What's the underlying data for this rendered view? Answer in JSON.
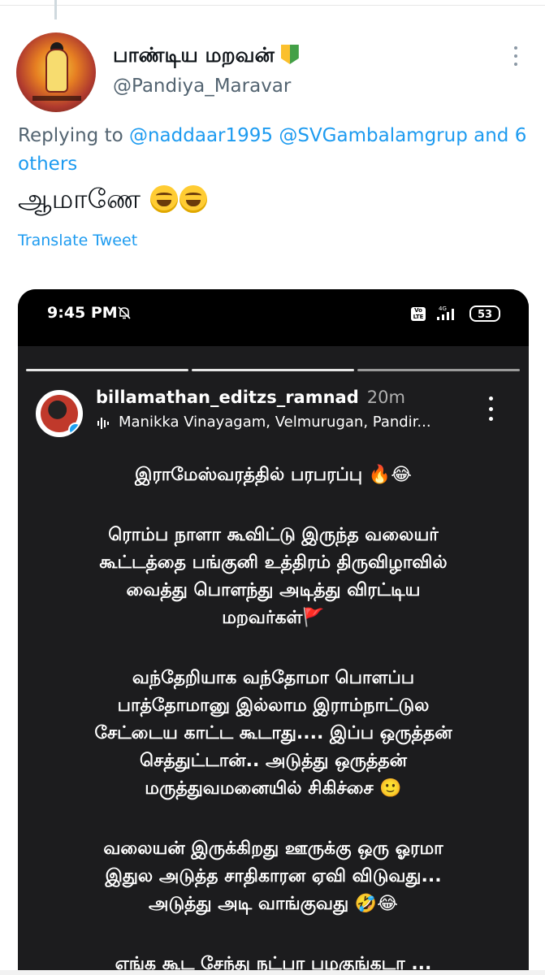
{
  "tweet": {
    "display_name": "பாண்டிய மறவன்",
    "handle": "@Pandiya_Maravar",
    "replying_prefix": "Replying to",
    "replying_mentions": "@naddaar1995 @SVGambalamgrup",
    "replying_suffix_connector": "and",
    "replying_others": "6 others",
    "text": "ஆமாணே",
    "translate_label": "Translate Tweet",
    "badge_icon": "beginner-badge-icon",
    "more_icon": "more-options-icon"
  },
  "story": {
    "status_bar": {
      "time": "9:45 PM",
      "volte_label": "Vo LTE",
      "network_label": "4G",
      "battery": "53"
    },
    "progress": [
      1,
      1,
      0
    ],
    "user": "billamathan_editzs_ramnad",
    "age": "20m",
    "music": "Manikka Vinayagam, Velmurugan, Pandir...",
    "paragraphs": [
      "இராமேஸ்வரத்தில் பரபரப்பு 🔥😂",
      "ரொம்ப நாளா கூவிட்டு இருந்த வலையர்\nகூட்டத்தை பங்குனி உத்திரம் திருவிழாவில்\nவைத்து பொளந்து அடித்து விரட்டிய\nமறவர்கள்🚩",
      "வந்தேறியாக வந்தோமா பொளப்ப\nபாத்தோமானு இல்லாம இராம்நாட்டுல\nசேட்டைய காட்ட கூடாது.... இப்ப ஒருத்தன்\nசெத்துட்டான்.. அடுத்து ஒருத்தன்\nமருத்துவமனையில் சிகிச்சை 🙂",
      "வலையன் இருக்கிறது ஊருக்கு ஒரு ஓரமா\nஇதுல அடுத்த சாதிகாரன ஏவி விடுவது...\nஅடுத்து அடி வாங்குவது 🤣😂",
      "எங்க கூட சேந்து நட்பா பழகுங்கடா ..."
    ]
  },
  "colors": {
    "link": "#1d9bf0",
    "secondary_text": "#536471",
    "story_bg": "#1c1c1e"
  }
}
